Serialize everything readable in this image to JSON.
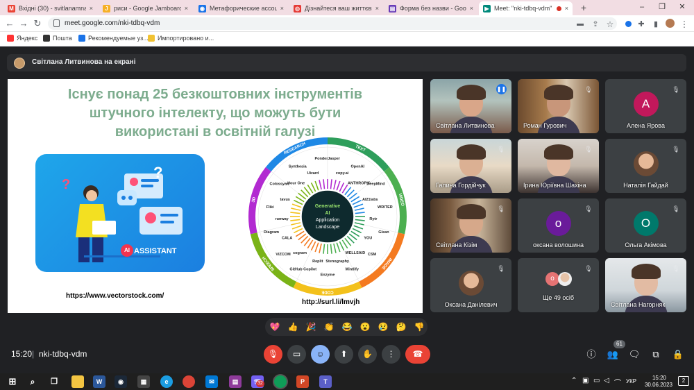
{
  "browser": {
    "tabs": [
      {
        "icon": "gmail-icon",
        "title": "Вхідні (30) - svitlanamnago",
        "color": "#ea4335",
        "glyph": "M"
      },
      {
        "icon": "jamboard-icon",
        "title": "риси - Google Jamboard",
        "color": "#f6b026",
        "glyph": "J"
      },
      {
        "icon": "site-icon",
        "title": "Метафорические ассоциа",
        "color": "#1a73e8",
        "glyph": "◉"
      },
      {
        "icon": "target-icon",
        "title": "Дізнайтеся ваш життєвий",
        "color": "#e53935",
        "glyph": "◎"
      },
      {
        "icon": "forms-icon",
        "title": "Форма без назви - Google",
        "color": "#673ab7",
        "glyph": "▤"
      },
      {
        "icon": "meet-icon",
        "title": "Meet: \"nki-tdbq-vdm\"",
        "color": "#00897b",
        "glyph": "▶",
        "active": true
      }
    ],
    "close_glyph": "×",
    "new_tab_glyph": "+",
    "window_controls": {
      "minimize": "–",
      "restore": "❐",
      "close": "✕"
    },
    "url": "meet.google.com/nki-tdbq-vdm",
    "bookmarks": [
      {
        "label": "Яндекс",
        "color": "#ff3333"
      },
      {
        "label": "Пошта",
        "color": "#333333"
      },
      {
        "label": "Рекомендуемые уз...",
        "color": "#1a73e8"
      },
      {
        "label": "Импортировано и...",
        "color": "#f1c232"
      }
    ]
  },
  "presenter": {
    "label": "Світлана Литвинова на екрані"
  },
  "slide": {
    "title_lines": [
      "Існує понад 25 безкоштовних інструментів",
      "штучного інтелекту, що можуть бути",
      "використані в освітній галузі"
    ],
    "badge": "AI",
    "assistant_label": "ASSISTANT",
    "source_left": "https://www.vectorstock.com/",
    "source_right": "http://surl.li/lmvjh",
    "wheel": {
      "center_lines": [
        "Generative",
        "AI",
        "Application",
        "Landscape"
      ],
      "segments": [
        {
          "label": "TEXT",
          "color": "#2e9e5b"
        },
        {
          "label": "VIDEO",
          "color": "#4caf50"
        },
        {
          "label": "IMAGE",
          "color": "#f47a20"
        },
        {
          "label": "CODE",
          "color": "#f3c11b"
        },
        {
          "label": "SPEECH",
          "color": "#7ab317"
        },
        {
          "label": "3D",
          "color": "#b22ad1"
        },
        {
          "label": "RESEARCH",
          "color": "#1e88e5"
        }
      ],
      "logos": [
        "Jasper",
        "copy.ai",
        "OpenAI",
        "ANTHROPIC",
        "DeepMind",
        "AI21labs",
        "WRITER",
        "Rytr",
        "Glean",
        "YOU",
        "CSM",
        "WELLSAID",
        "Mintlify",
        "Steno­graphy",
        "Enzyme",
        "Replit",
        "GitHub Copilot",
        "cogram",
        "VIZCOM",
        "CALA",
        "Diagram",
        "runway",
        "Fliki",
        "tavus",
        "Colossyan",
        "Hour One",
        "Synthesia",
        "Uizard",
        "Ponder"
      ]
    }
  },
  "participants": [
    {
      "name": "Світлана Литвинова",
      "type": "video",
      "speaking": true
    },
    {
      "name": "Роман Гурович",
      "type": "video"
    },
    {
      "name": "Алена Ярова",
      "type": "avatar",
      "initial": "А",
      "color": "#c2185b"
    },
    {
      "name": "Галина Гордійчук",
      "type": "video"
    },
    {
      "name": "Ірина Юріївна Шахіна",
      "type": "video"
    },
    {
      "name": "Наталія Гайдай",
      "type": "photo"
    },
    {
      "name": "Світлана Кізім",
      "type": "video"
    },
    {
      "name": "оксана волошина",
      "type": "avatar",
      "initial": "о",
      "color": "#6a1b9a"
    },
    {
      "name": "Ольга Акімова",
      "type": "avatar",
      "initial": "О",
      "color": "#00796b"
    },
    {
      "name": "Оксана Данілевич",
      "type": "photo"
    },
    {
      "name": "Ще 49 осіб",
      "type": "more",
      "initial": "о"
    },
    {
      "name": "Світлана Нагорняк",
      "type": "video"
    }
  ],
  "reactions": [
    "💖",
    "👍",
    "🎉",
    "👏",
    "😂",
    "😮",
    "😢",
    "🤔",
    "👎"
  ],
  "bottom": {
    "time": "15:20",
    "separator": "|",
    "meeting_code": "nki-tdbq-vdm",
    "participant_count": "61",
    "controls": [
      {
        "name": "mic-toggle-button",
        "icon": "mic-off-icon",
        "glyph": "🎙",
        "color": "#ea4335"
      },
      {
        "name": "camera-toggle-button",
        "icon": "camera-icon",
        "glyph": "▭",
        "color": "#3c4043"
      },
      {
        "name": "reactions-button",
        "icon": "emoji-icon",
        "glyph": "☺",
        "color": "#8ab4f8"
      },
      {
        "name": "present-button",
        "icon": "present-icon",
        "glyph": "⬆",
        "color": "#3c4043"
      },
      {
        "name": "raise-hand-button",
        "icon": "hand-icon",
        "glyph": "✋",
        "color": "#3c4043"
      },
      {
        "name": "more-options-button",
        "icon": "more-icon",
        "glyph": "⋮",
        "color": "#3c4043"
      },
      {
        "name": "leave-call-button",
        "icon": "phone-hangup-icon",
        "glyph": "☎",
        "color": "#ea4335"
      }
    ]
  },
  "taskbar": {
    "clock_time": "15:20",
    "clock_date": "30.06.2023",
    "language": "УКР",
    "badge_count": "32",
    "notification_count": "2"
  }
}
